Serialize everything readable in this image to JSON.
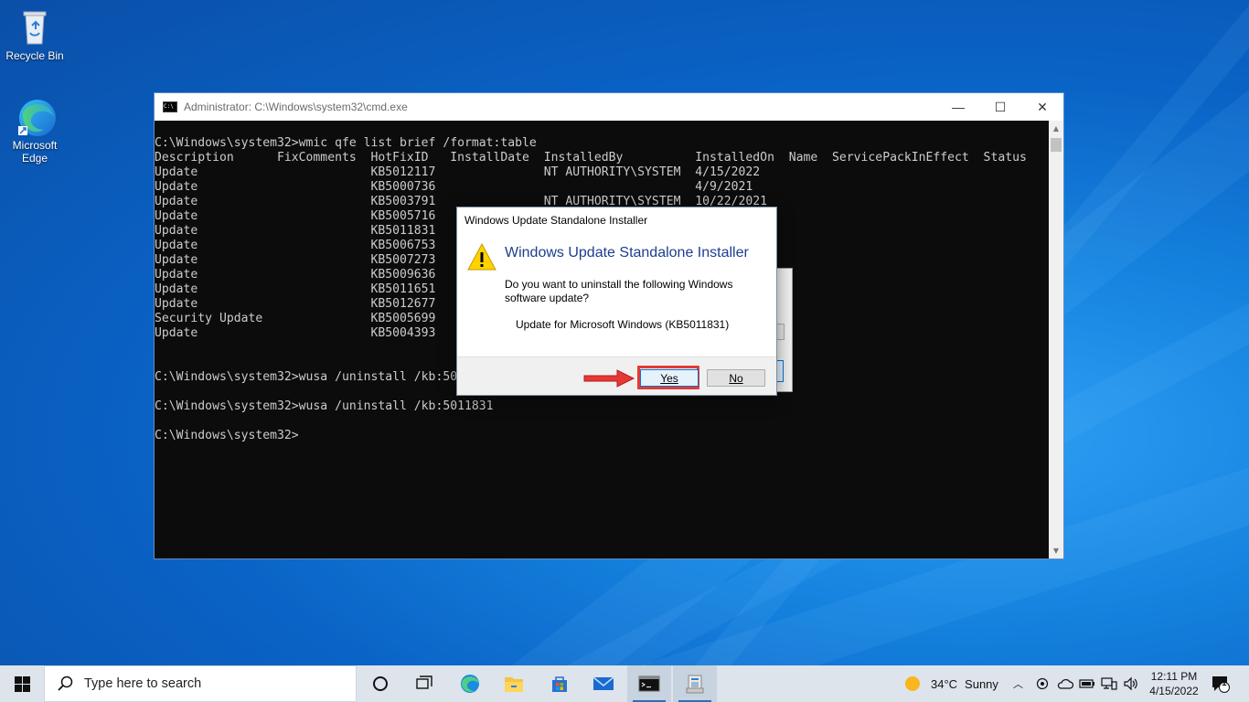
{
  "desktop": {
    "icons": [
      {
        "label": "Recycle Bin",
        "icon": "recycle-bin-icon"
      },
      {
        "label": "Microsoft Edge",
        "label_line1": "Microsoft",
        "label_line2": "Edge",
        "icon": "edge-icon"
      }
    ]
  },
  "cmd_window": {
    "title": "Administrator: C:\\Windows\\system32\\cmd.exe",
    "controls": {
      "minimize": "—",
      "maximize": "☐",
      "close": "✕"
    },
    "lines": [
      "C:\\Windows\\system32>wmic qfe list brief /format:table",
      "Description      FixComments  HotFixID   InstallDate  InstalledBy          InstalledOn  Name  ServicePackInEffect  Status",
      "Update                        KB5012117               NT AUTHORITY\\SYSTEM  4/15/2022",
      "Update                        KB5000736                                    4/9/2021",
      "Update                        KB5003791               NT AUTHORITY\\SYSTEM  10/22/2021",
      "Update                        KB5005716",
      "Update                        KB5011831",
      "Update                        KB5006753",
      "Update                        KB5007273",
      "Update                        KB5009636",
      "Update                        KB5011651",
      "Update                        KB5012677",
      "Security Update               KB5005699",
      "Update                        KB5004393",
      "",
      "",
      "C:\\Windows\\system32>wusa /uninstall /kb:50",
      "",
      "C:\\Windows\\system32>wusa /uninstall /kb:5011831",
      "",
      "C:\\Windows\\system32>"
    ]
  },
  "dialog": {
    "title": "Windows Update Standalone Installer",
    "heading": "Windows Update Standalone Installer",
    "question": "Do you want to uninstall the following Windows software update?",
    "update_name": "Update for Microsoft Windows (KB5011831)",
    "yes_label": "Yes",
    "no_label": "No",
    "highlight_color": "#e53935"
  },
  "taskbar": {
    "search_placeholder": "Type here to search",
    "weather": {
      "temp": "34°C",
      "condition": "Sunny"
    },
    "clock": {
      "time": "12:11 PM",
      "date": "4/15/2022"
    },
    "notification_count": "1",
    "pinned": [
      "task-view-icon",
      "edge-icon",
      "file-explorer-icon",
      "store-icon",
      "mail-icon",
      "cmd-icon",
      "installer-icon"
    ]
  }
}
